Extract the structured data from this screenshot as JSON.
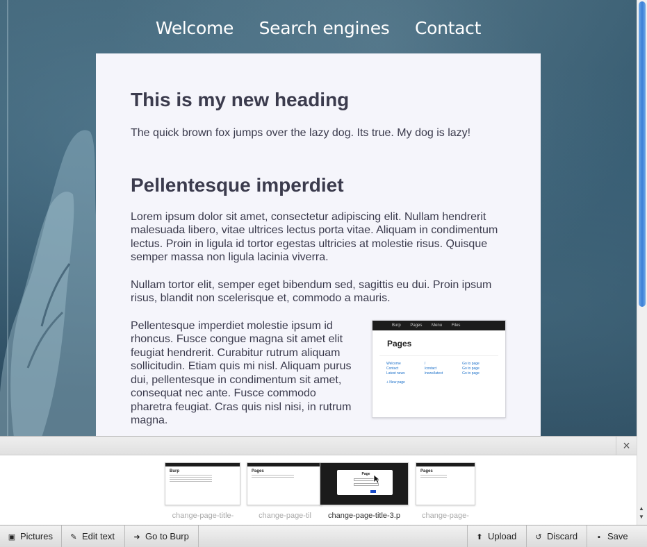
{
  "nav": {
    "items": [
      "Welcome",
      "Search engines",
      "Contact"
    ]
  },
  "content": {
    "heading1": "This is my new heading",
    "intro": "The quick brown fox jumps over the lazy dog. Its true. My dog is lazy!",
    "heading2": "Pellentesque imperdiet",
    "para1": "Lorem ipsum dolor sit amet, consectetur adipiscing elit. Nullam hendrerit malesuada libero, vitae ultrices lectus porta vitae. Aliquam in condimentum lectus. Proin in ligula id tortor egestas ultricies at molestie risus. Quisque semper massa non ligula lacinia viverra.",
    "para2": "Nullam tortor elit, semper eget bibendum sed, sagittis eu dui. Proin ipsum risus, blandit non scelerisque et, commodo a mauris.",
    "para3": "Pellentesque imperdiet molestie ipsum id rhoncus. Fusce congue magna sit amet elit feugiat hendrerit. Curabitur rutrum aliquam sollicitudin. Etiam quis mi nisl. Aliquam purus dui, pellentesque in condimentum sit amet, consequat nec ante. Fusce commodo pharetra feugiat. Cras quis nisl nisi, in rutrum magna."
  },
  "inline_screenshot": {
    "bar_items": [
      "Burp",
      "Pages",
      "Menu",
      "Files"
    ],
    "title": "Pages",
    "rows": [
      [
        "Welcome",
        "/",
        "Go to page"
      ],
      [
        "Contact",
        "/contact",
        "Go to page"
      ],
      [
        "Latest news",
        "/news/latest",
        "Go to page"
      ]
    ],
    "new_page": "+ New page"
  },
  "drawer": {
    "close_label": "×",
    "thumbnails": [
      {
        "caption": "change-page-title-",
        "selected": false,
        "title": "Burp"
      },
      {
        "caption": "change-page-til",
        "selected": false,
        "title": "Pages"
      },
      {
        "caption": "change-page-title-3.p",
        "selected": true,
        "title": "Page"
      },
      {
        "caption": "change-page-",
        "selected": false,
        "title": "Pages"
      }
    ]
  },
  "toolbar": {
    "pictures": "Pictures",
    "edit_text": "Edit text",
    "go_to_burp": "Go to Burp",
    "upload": "Upload",
    "discard": "Discard",
    "save": "Save"
  },
  "colors": {
    "panel_bg": "#f5f5fb",
    "text": "#3a3a4c",
    "scroll_thumb": "#3b7fd6"
  }
}
